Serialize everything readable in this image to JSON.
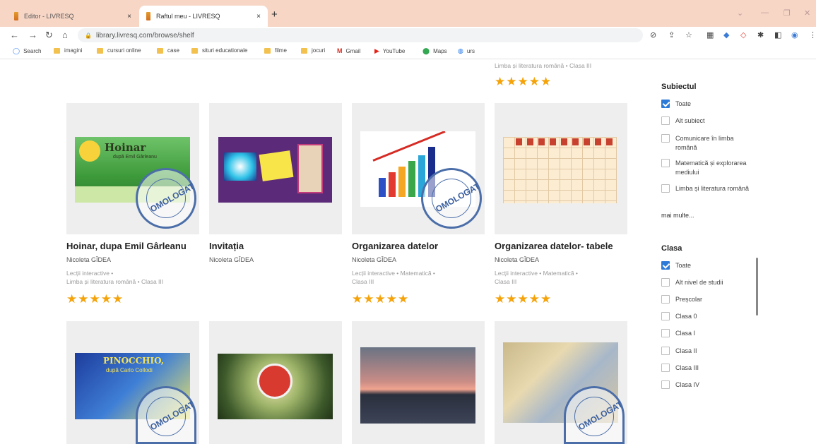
{
  "browser": {
    "tabs": [
      {
        "title": "Editor - LIVRESQ",
        "close": "×"
      },
      {
        "title": "Raftul meu - LIVRESQ",
        "close": "×"
      }
    ],
    "new_tab": "+",
    "url": "library.livresq.com/browse/shelf"
  },
  "bookmarks": [
    {
      "label": "Search",
      "icon": "search-icon"
    },
    {
      "label": "imagini",
      "icon": "folder-icon"
    },
    {
      "label": "cursuri online",
      "icon": "folder-icon"
    },
    {
      "label": "case",
      "icon": "folder-icon"
    },
    {
      "label": "situri educationale",
      "icon": "folder-icon"
    },
    {
      "label": "filme",
      "icon": "folder-icon"
    },
    {
      "label": "jocuri",
      "icon": "folder-icon"
    },
    {
      "label": "Gmail",
      "icon": "gmail-icon"
    },
    {
      "label": "YouTube",
      "icon": "youtube-icon"
    },
    {
      "label": "Maps",
      "icon": "maps-icon"
    },
    {
      "label": "urs",
      "icon": "globe-icon"
    }
  ],
  "top_partial": {
    "meta": "Limba și literatura română • Clasa III",
    "stars": "★★★★★"
  },
  "cards": [
    {
      "title": "Hoinar, dupa Emil Gârleanu",
      "author": "Nicoleta GÎDEA",
      "meta1": "Lecții interactive •",
      "meta2": "Limba și literatura română • Clasa III",
      "stars": "★★★★★",
      "thumb_title": "Hoinar",
      "thumb_sub": "după Emil Gârleanu"
    },
    {
      "title": "Invitația",
      "author": "Nicoleta GÎDEA",
      "meta1": "",
      "meta2": "",
      "stars": ""
    },
    {
      "title": "Organizarea datelor",
      "author": "Nicoleta GÎDEA",
      "meta1": "Lecții interactive • Matematică •",
      "meta2": "Clasa III",
      "stars": "★★★★★"
    },
    {
      "title": "Organizarea datelor- tabele",
      "author": "Nicoleta GÎDEA",
      "meta1": "Lecții interactive • Matematică •",
      "meta2": "Clasa III",
      "stars": "★★★★★"
    }
  ],
  "row2_thumbs": {
    "pinocchio_title": "PINOCCHIO,",
    "pinocchio_sub": "după Carlo Collodi"
  },
  "stamp": {
    "text": "OMOLOGAT"
  },
  "filters": {
    "subject": {
      "heading": "Subiectul",
      "items": [
        {
          "label": "Toate",
          "checked": true
        },
        {
          "label": "Alt subiect",
          "checked": false
        },
        {
          "label": "Comunicare în limba română",
          "checked": false
        },
        {
          "label": "Matematică și explorarea mediului",
          "checked": false
        },
        {
          "label": "Limba și literatura română",
          "checked": false
        }
      ],
      "more": "mai multe..."
    },
    "grade": {
      "heading": "Clasa",
      "items": [
        {
          "label": "Toate",
          "checked": true
        },
        {
          "label": "Alt nivel de studii",
          "checked": false
        },
        {
          "label": "Preșcolar",
          "checked": false
        },
        {
          "label": "Clasa 0",
          "checked": false
        },
        {
          "label": "Clasa I",
          "checked": false
        },
        {
          "label": "Clasa II",
          "checked": false
        },
        {
          "label": "Clasa III",
          "checked": false
        },
        {
          "label": "Clasa IV",
          "checked": false
        }
      ]
    }
  },
  "colors": {
    "accent": "#2e7ad8",
    "star": "#f4a30a",
    "tabstrip": "#f7d6c6",
    "stamp": "#4b6ea9"
  }
}
